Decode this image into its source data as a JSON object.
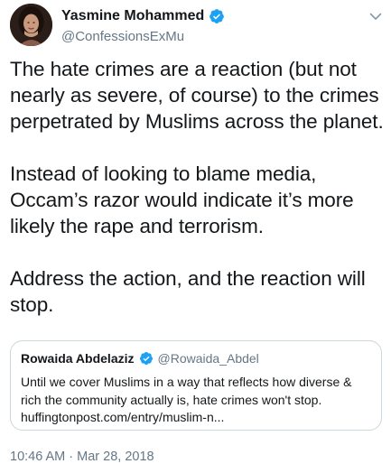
{
  "tweet": {
    "author": {
      "display_name": "Yasmine Mohammed",
      "handle": "@ConfessionsExMu",
      "verified": true
    },
    "paragraphs": [
      "The hate crimes are a reaction (but not\nnearly as severe, of course) to the crimes\nperpetrated by Muslims across the planet.",
      "Instead of looking to blame media,\nOccam’s razor would indicate it’s more\nlikely the rape and terrorism.",
      "Address the action, and the reaction will\nstop."
    ],
    "quote": {
      "display_name": "Rowaida Abdelaziz",
      "handle": "@Rowaida_Abdel",
      "verified": true,
      "text_lines": [
        "Until we cover Muslims in a way that reflects how diverse &",
        "rich the community actually is, hate crimes won't stop.",
        "huffingtonpost.com/entry/muslim-n..."
      ]
    },
    "timestamp": "10:46 AM · Mar 28, 2018"
  },
  "icons": {
    "verified": "verified-badge-icon",
    "menu": "chevron-down-icon"
  },
  "colors": {
    "text_primary": "#14171a",
    "text_secondary": "#657786",
    "verified_blue": "#1da1f2",
    "border": "#ccd6dd"
  }
}
